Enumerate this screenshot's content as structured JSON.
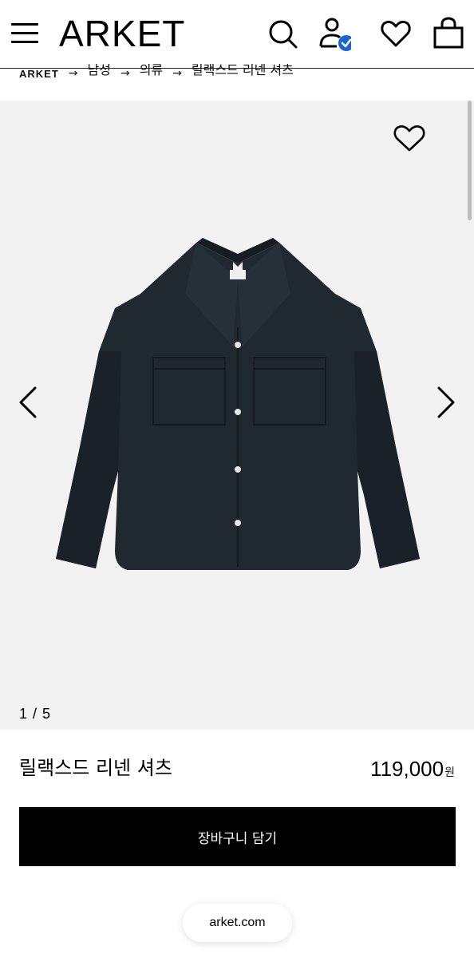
{
  "header": {
    "logo": "ARKET",
    "icons": [
      "menu-icon",
      "search-icon",
      "account-verified-icon",
      "wishlist-heart-icon",
      "shopping-bag-icon"
    ],
    "verified_badge_color": "#1a63d6"
  },
  "breadcrumb": {
    "items": [
      "ARKET",
      "남성",
      "의류",
      "릴랙스드 리넨 셔츠"
    ]
  },
  "gallery": {
    "counter": "1 / 5",
    "background": "#f2f2f2",
    "product_color": "#202830"
  },
  "product": {
    "name": "릴랙스드 리넨 셔츠",
    "price": "119,000",
    "currency": "원"
  },
  "actions": {
    "add_to_cart": "장바구니 담기"
  },
  "browser": {
    "url": "arket.com"
  }
}
